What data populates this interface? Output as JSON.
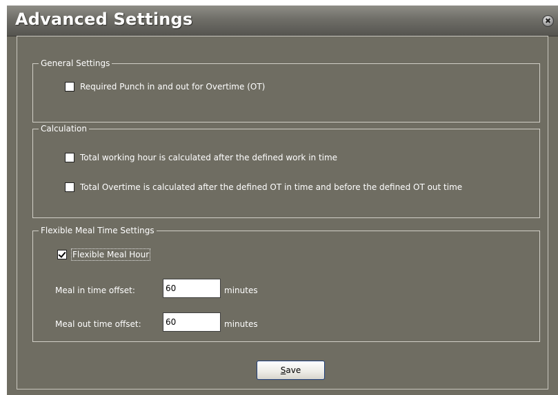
{
  "window": {
    "title": "Advanced Settings",
    "close_glyph": "✖"
  },
  "general": {
    "legend": "General Settings",
    "items": [
      {
        "label": "Required Punch in and out for Overtime (OT)",
        "checked": false
      }
    ]
  },
  "calculation": {
    "legend": "Calculation",
    "items": [
      {
        "label": "Total working hour is calculated after the defined work in time",
        "checked": false
      },
      {
        "label": "Total Overtime is calculated after the defined OT in time and before the defined OT out time",
        "checked": false
      }
    ]
  },
  "meal": {
    "legend": "Flexible Meal Time Settings",
    "flexible_label": "Flexible Meal Hour",
    "flexible_checked": true,
    "in_label": "Meal in time offset:",
    "in_value": "60",
    "out_label": "Meal out time offset:",
    "out_value": "60",
    "unit": "minutes"
  },
  "buttons": {
    "save_mnemonic": "S",
    "save_rest": "ave"
  },
  "colors": {
    "panel": "#6f6d62",
    "text": "#ffffff",
    "button_border": "#1d3d7a"
  },
  "icons": {
    "close": "close-icon"
  }
}
